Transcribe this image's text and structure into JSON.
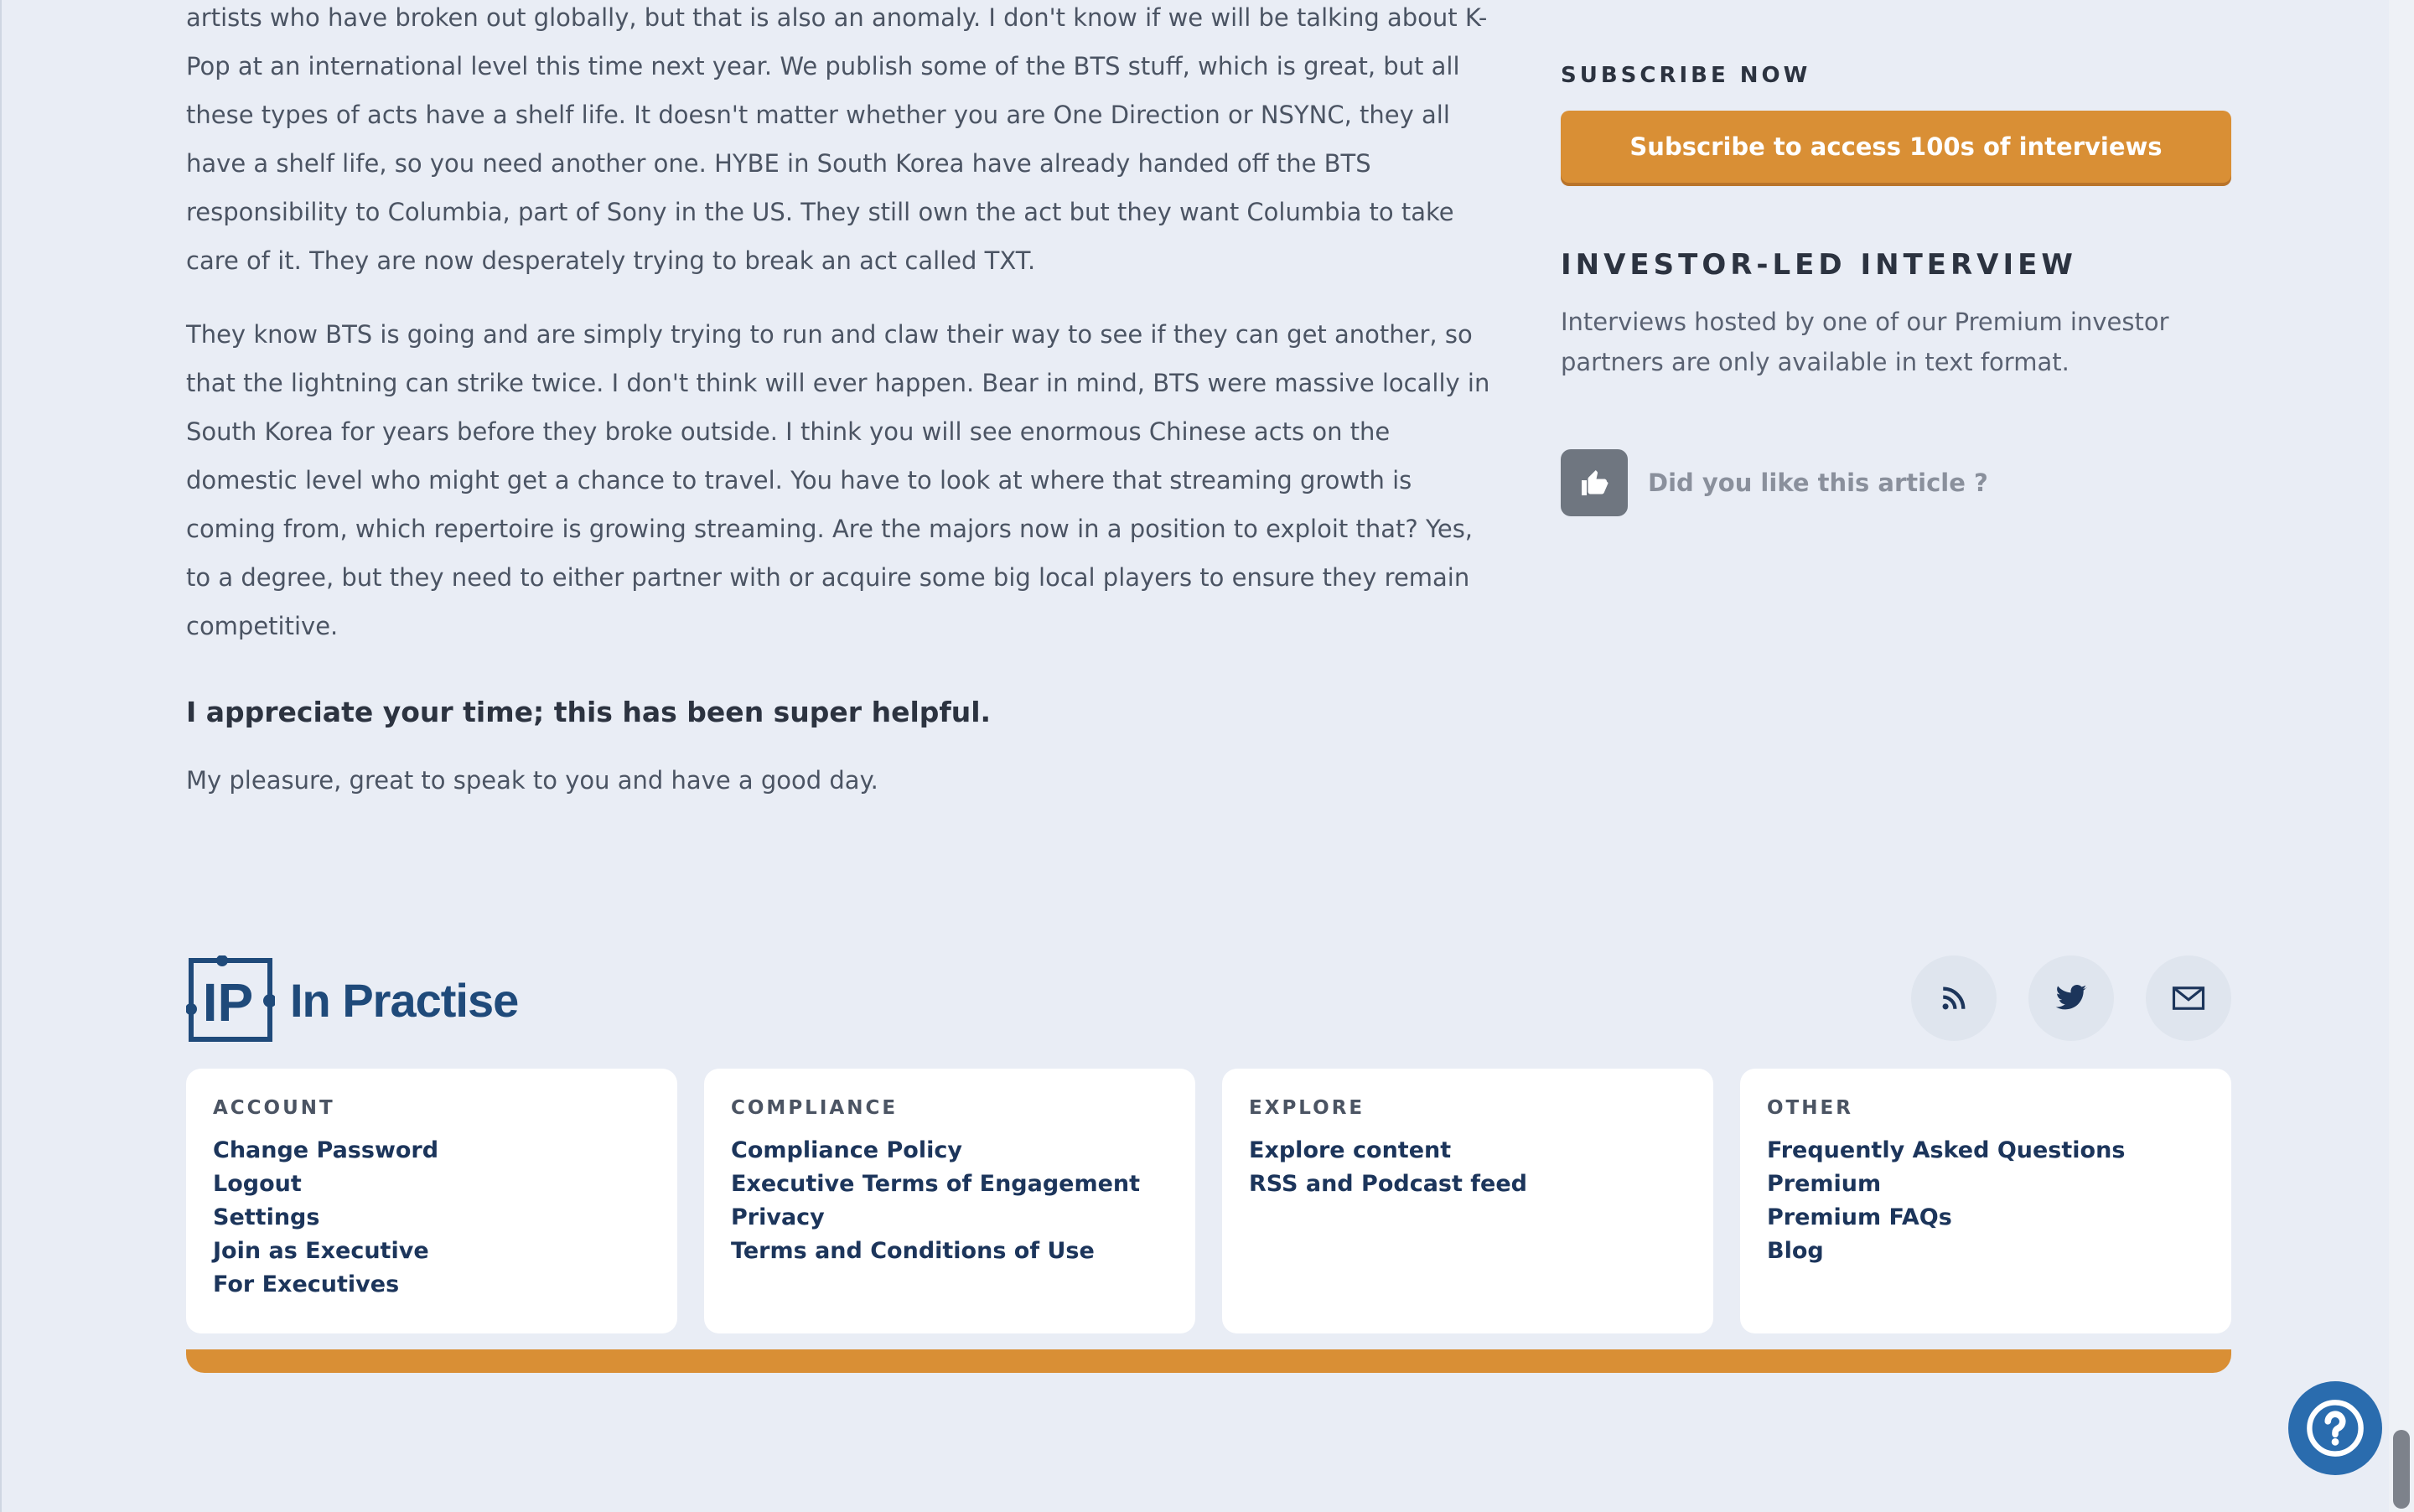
{
  "article": {
    "paragraphs": [
      "artists who have broken out globally, but that is also an anomaly. I don't know if we will be talking about K-Pop at an international level this time next year. We publish some of the BTS stuff, which is great, but all these types of acts have a shelf life. It doesn't matter whether you are One Direction or NSYNC, they all have a shelf life, so you need another one. HYBE in South Korea have already handed off the BTS responsibility to Columbia, part of Sony in the US. They still own the act but they want Columbia to take care of it. They are now desperately trying to break an act called TXT.",
      "They know BTS is going and are simply trying to run and claw their way to see if they can get another, so that the lightning can strike twice. I don't think will ever happen. Bear in mind, BTS were massive locally in South Korea for years before they broke outside. I think you will see enormous Chinese acts on the domestic level who might get a chance to travel. You have to look at where that streaming growth is coming from, which repertoire is growing streaming. Are the majors now in a position to exploit that? Yes, to a degree, but they need to either partner with or acquire some big local players to ensure they remain competitive."
    ],
    "question": "I appreciate your time; this has been super helpful.",
    "answer": "My pleasure, great to speak to you and have a good day."
  },
  "sidebar": {
    "subscribe_heading": "SUBSCRIBE NOW",
    "subscribe_button": "Subscribe to access 100s of interviews",
    "investor_heading": "INVESTOR-LED INTERVIEW",
    "investor_text": "Interviews hosted by one of our Premium investor partners are only available in text format.",
    "like_label": "Did you like this article ?",
    "like_icon": "thumbs-up-icon"
  },
  "footer": {
    "brand_name": "In Practise",
    "logo_letters": "IP",
    "social_icons": [
      "rss-icon",
      "twitter-icon",
      "mail-icon"
    ],
    "columns": [
      {
        "title": "ACCOUNT",
        "links": [
          "Change Password",
          "Logout",
          "Settings",
          "Join as Executive",
          "For Executives"
        ]
      },
      {
        "title": "COMPLIANCE",
        "links": [
          "Compliance Policy",
          "Executive Terms of Engagement",
          "Privacy",
          "Terms and Conditions of Use"
        ]
      },
      {
        "title": "EXPLORE",
        "links": [
          "Explore content",
          "RSS and Podcast feed"
        ]
      },
      {
        "title": "OTHER",
        "links": [
          "Frequently Asked Questions",
          "Premium",
          "Premium FAQs",
          "Blog"
        ]
      }
    ]
  },
  "help_icon": "question-mark-icon",
  "colors": {
    "accent": "#d98f35",
    "brand": "#1f4a7a",
    "help": "#2a6cae",
    "background": "#e9edf5"
  }
}
